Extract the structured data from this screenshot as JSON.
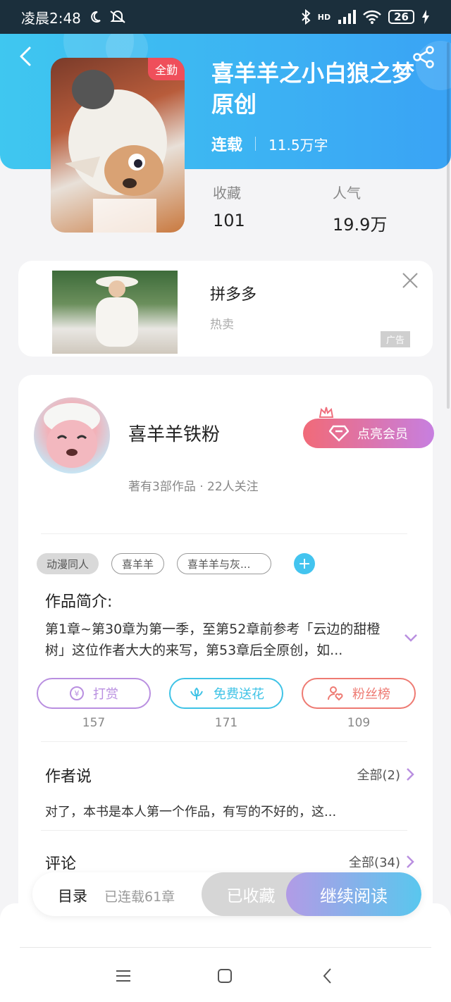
{
  "status_bar": {
    "time": "凌晨2:48",
    "battery": "26",
    "network": "HD"
  },
  "header": {
    "cover_badge": "全勤",
    "title": "喜羊羊之小白狼之梦原创",
    "status": "连载",
    "word_count": "11.5万字",
    "stats": [
      {
        "label": "收藏",
        "value": "101"
      },
      {
        "label": "人气",
        "value": "19.9万"
      }
    ]
  },
  "ad": {
    "title": "拼多多",
    "subtitle": "热卖",
    "tag": "广告"
  },
  "author": {
    "name": "喜羊羊铁粉",
    "info": "著有3部作品 · 22人关注",
    "vip_label": "点亮会员"
  },
  "tags": [
    "动漫同人",
    "喜羊羊",
    "喜羊羊与灰..."
  ],
  "intro": {
    "title": "作品简介:",
    "text": "第1章~第30章为第一季，至第52章前参考「云边的甜橙树」这位作者大大的来写，第53章后全原创，如..."
  },
  "actions": [
    {
      "label": "打赏",
      "count": "157",
      "color": "#b98fe0"
    },
    {
      "label": "免费送花",
      "count": "171",
      "color": "#3fc3e6"
    },
    {
      "label": "粉丝榜",
      "count": "109",
      "color": "#ee7a72"
    }
  ],
  "author_say": {
    "title": "作者说",
    "all_label": "全部(2)",
    "text": "对了，本书是本人第一个作品，有写的不好的，这..."
  },
  "comments": {
    "title": "评论",
    "all_label": "全部(34)"
  },
  "bottom_bar": {
    "toc_label": "目录",
    "toc_count": "已连载61章",
    "fav_label": "已收藏",
    "read_label": "继续阅读"
  },
  "colors": {
    "header_gradient_start": "#3fc7f0",
    "header_gradient_end": "#3aa3f5",
    "accent_purple": "#b98fe0",
    "accent_cyan": "#3fc3e6",
    "accent_red": "#ee7a72"
  }
}
